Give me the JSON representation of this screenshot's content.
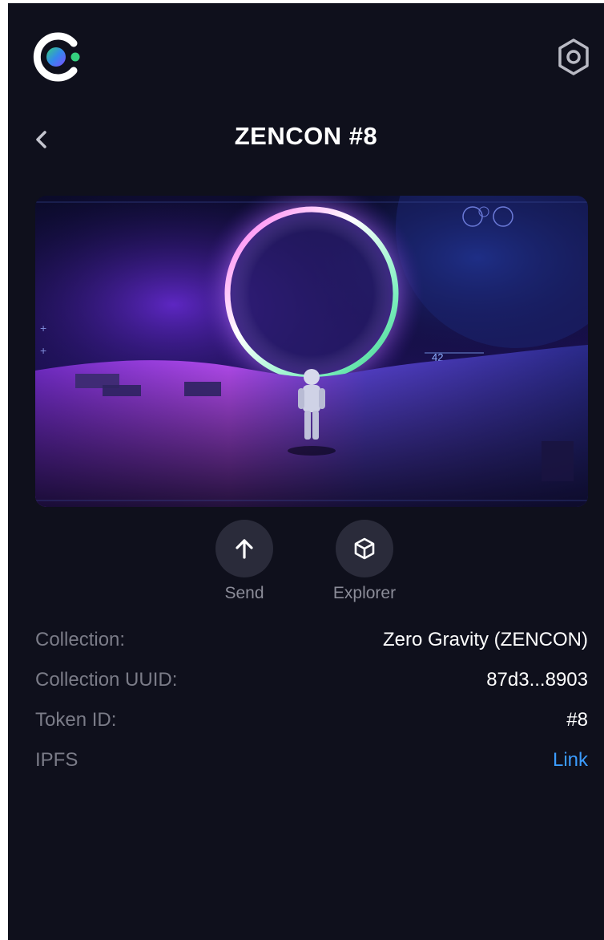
{
  "header": {
    "logo_icon": "celo-logo-icon",
    "settings_icon": "hexagon-settings-icon"
  },
  "nav": {
    "back_icon": "chevron-left-icon",
    "title": "ZENCON #8"
  },
  "actions": [
    {
      "label": "Send",
      "icon": "arrow-up-icon"
    },
    {
      "label": "Explorer",
      "icon": "cube-icon"
    }
  ],
  "details": [
    {
      "key": "Collection:",
      "value": "Zero Gravity (ZENCON)"
    },
    {
      "key": "Collection UUID:",
      "value": "87d3...8903"
    },
    {
      "key": "Token ID:",
      "value": "#8"
    },
    {
      "key": "IPFS",
      "value": "Link"
    }
  ],
  "colors": {
    "background": "#0f101c",
    "accent_link": "#3b9cff",
    "muted_text": "#7b7c88",
    "button_bg": "#2a2b3a"
  }
}
